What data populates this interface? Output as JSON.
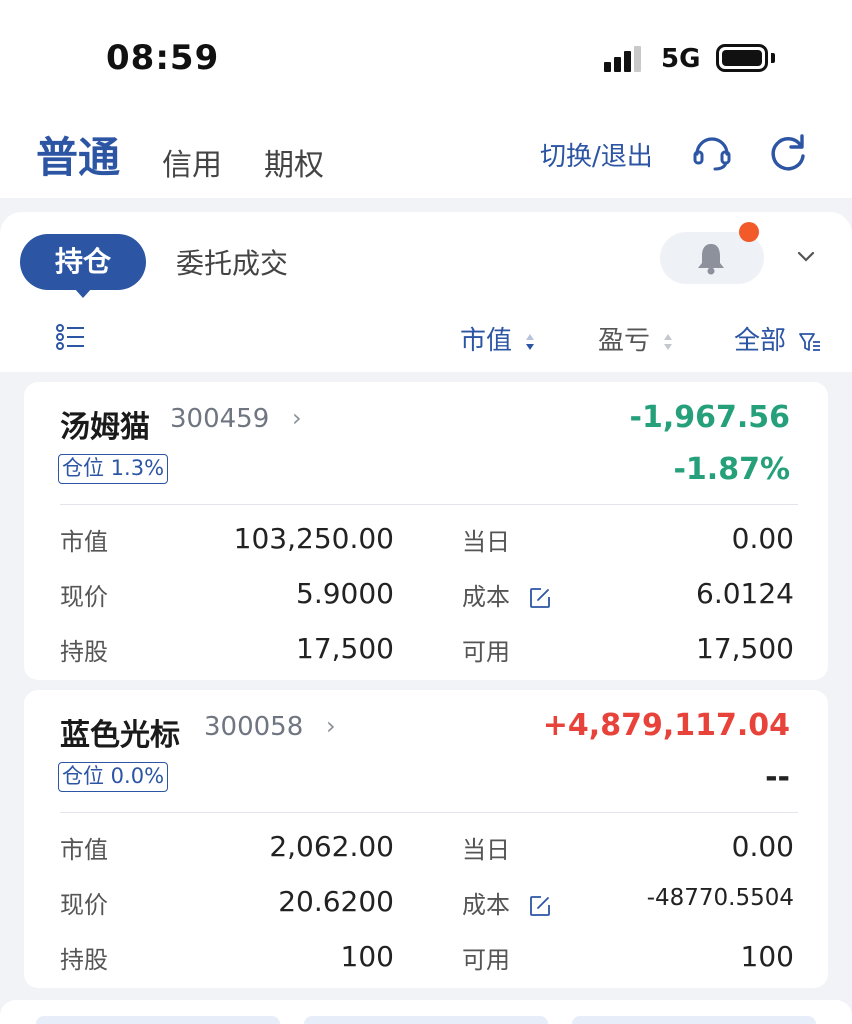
{
  "status_bar": {
    "time": "08:59",
    "network": "5G"
  },
  "header": {
    "tabs": [
      {
        "label": "普通",
        "active": true
      },
      {
        "label": "信用",
        "active": false
      },
      {
        "label": "期权",
        "active": false
      }
    ],
    "switch_label": "切换/退出",
    "icons": [
      "headset-icon",
      "refresh-icon"
    ]
  },
  "subtabs": {
    "positions": "持仓",
    "orders": "委托成交"
  },
  "sort_bar": {
    "market_value": "市值",
    "profit_loss": "盈亏",
    "filter": "全部"
  },
  "labels": {
    "market_value": "市值",
    "today": "当日",
    "price": "现价",
    "cost": "成本",
    "shares": "持股",
    "available": "可用"
  },
  "positions": [
    {
      "name": "汤姆猫",
      "code": "300459",
      "weight": "仓位 1.3%",
      "pnl": "-1,967.56",
      "pnl_pct": "-1.87%",
      "market_value": "103,250.00",
      "today": "0.00",
      "price": "5.9000",
      "cost": "6.0124",
      "shares": "17,500",
      "available": "17,500"
    },
    {
      "name": "蓝色光标",
      "code": "300058",
      "weight": "仓位 0.0%",
      "pnl": "+4,879,117.04",
      "pnl_pct": "--",
      "market_value": "2,062.00",
      "today": "0.00",
      "price": "20.6200",
      "cost": "-48770.5504",
      "shares": "100",
      "available": "100"
    }
  ],
  "colors": {
    "brand": "#2c55a4",
    "loss": "#25a07a",
    "gain": "#e8433a",
    "notification": "#f25a2a"
  }
}
